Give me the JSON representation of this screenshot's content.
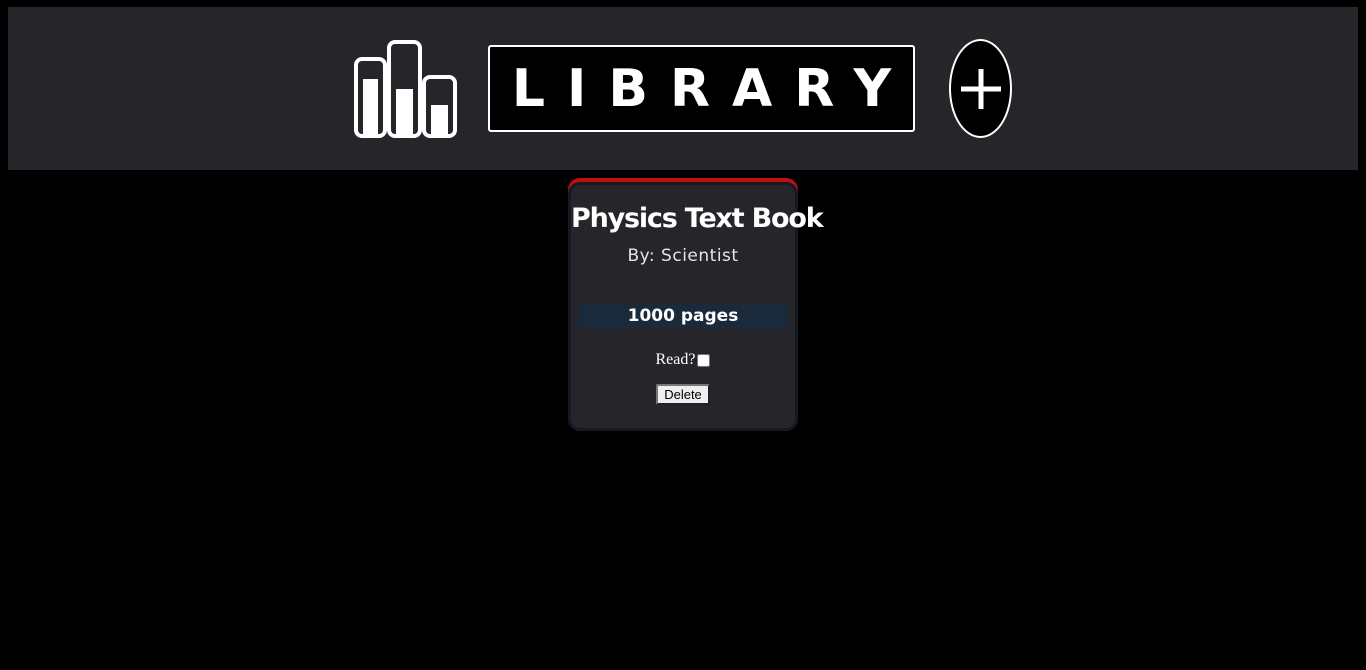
{
  "header": {
    "title": "LIBRARY",
    "logo_icon": "library-books-icon",
    "add_icon": "plus-icon"
  },
  "books": [
    {
      "title": "Physics Text Book",
      "author": "By: Scientist",
      "pages": "1000 pages",
      "read_label": "Read?",
      "read": false,
      "delete_label": "Delete"
    }
  ],
  "colors": {
    "page_background": "#000000",
    "header_background": "#25252a",
    "card_background": "#25252a",
    "card_accent": "#c30d13",
    "pages_band": "#1b2a3a",
    "text": "#ffffff"
  }
}
